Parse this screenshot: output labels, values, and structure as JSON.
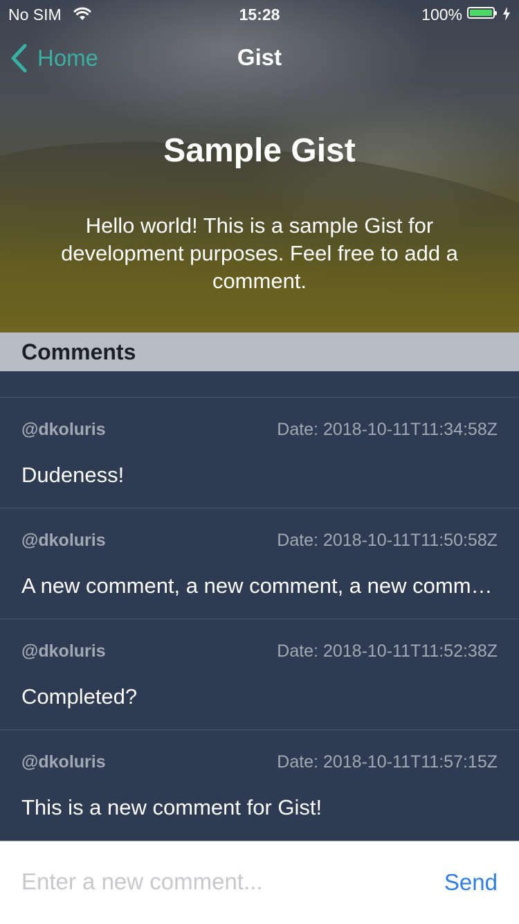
{
  "status_bar": {
    "carrier": "No SIM",
    "time": "15:28",
    "battery": "100%",
    "battery_level": 1.0,
    "battery_color": "#4cd964"
  },
  "nav": {
    "back_label": "Home",
    "title": "Gist",
    "accent_color": "#3ab0a4"
  },
  "gist": {
    "title": "Sample Gist",
    "description": "Hello world! This is a sample Gist for development purposes. Feel free to add a comment."
  },
  "comments_section": {
    "header": "Comments",
    "items": [
      {
        "user": "@dkoluris",
        "date": "Date: 2018-10-11T11:34:58Z",
        "body": "Dudeness!"
      },
      {
        "user": "@dkoluris",
        "date": "Date: 2018-10-11T11:50:58Z",
        "body": "A new comment, a new comment, a new comment, a new comment"
      },
      {
        "user": "@dkoluris",
        "date": "Date: 2018-10-11T11:52:38Z",
        "body": "Completed?"
      },
      {
        "user": "@dkoluris",
        "date": "Date: 2018-10-11T11:57:15Z",
        "body": "This is a new comment for Gist!"
      }
    ]
  },
  "composer": {
    "placeholder": "Enter a new comment...",
    "value": "",
    "send_label": "Send",
    "send_color": "#2f7ee0"
  },
  "icons": {
    "wifi": "wifi-icon",
    "battery": "battery-icon",
    "charging": "charging-bolt-icon",
    "back": "chevron-left-icon"
  }
}
